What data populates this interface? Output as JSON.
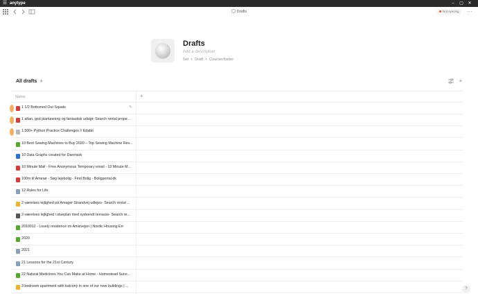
{
  "os": {
    "app_name": "anytype",
    "menu_glyph": "☰",
    "minimize": "–",
    "maximize": "▢",
    "close": "✕"
  },
  "header": {
    "breadcrumb": "Drafts",
    "sync_status": "Not syncing",
    "more": "···"
  },
  "object": {
    "title": "Drafts",
    "description_placeholder": "Add a description",
    "meta": [
      "Set",
      "•",
      "Draft",
      "•",
      "Coursecharter"
    ]
  },
  "view": {
    "title": "All drafts",
    "add": "+",
    "settings_glyph": "⇅",
    "add_object": "+"
  },
  "table": {
    "column_name": "Name",
    "add_column": "+",
    "rows": [
      {
        "label": "1 1/2 Bottomed Out Squats",
        "color": "#d23c3c"
      },
      {
        "label": "1 altan, god planløsning og fantastisk udsigt- Search rental prope...",
        "color": "#d23c3c"
      },
      {
        "label": "1,500+ Python Practice Challenges // Edabit",
        "color": "#b8b8b8"
      },
      {
        "label": "10 Best Sewing Machines to Buy 2020 – Top Sewing Machine Rev...",
        "color": "#5aa632"
      },
      {
        "label": "10 Data Graphs created for Danmark",
        "color": "#2f6fd0"
      },
      {
        "label": "10 Minute Mail - Free Anonymous Temporary email - 10 Minute M...",
        "color": "#d23c3c"
      },
      {
        "label": "100m til Amesø - Søg lejebolig - Find Bolig - Boligportal.dk",
        "color": "#d23c3c"
      },
      {
        "label": "12 Rules for Life",
        "color": "#8aa0b8"
      },
      {
        "label": "2 værelses lejlighed på Amager Strandvej udlejes- Search rental ...",
        "color": "#e9b430"
      },
      {
        "label": "2-værelses lejlighed i stueplan med sydvendt terrasse- Search re...",
        "color": "#555555"
      },
      {
        "label": "2010012 - Lovely residence on Amisvejen | Nordic Housing Err",
        "color": "#5aa632"
      },
      {
        "label": "2020",
        "color": "#5aa632"
      },
      {
        "label": "2021",
        "color": "#8aa0b8"
      },
      {
        "label": "21 Lessons for the 21st Century",
        "color": "#8aa0b8"
      },
      {
        "label": "22 Natural Medicines You Can Make at Home - Homestead Survi...",
        "color": "#5aa632"
      },
      {
        "label": "3 bedroom apartment with balcony in one of our new buildings | ...",
        "color": "#e9b430"
      }
    ]
  },
  "help": "?"
}
